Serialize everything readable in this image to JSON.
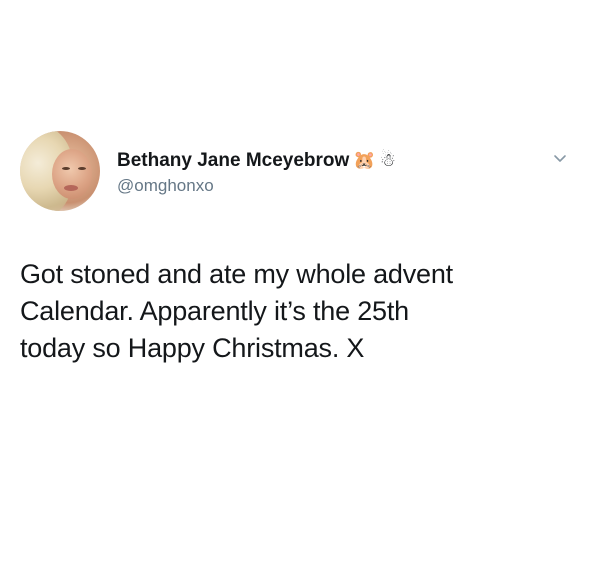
{
  "tweet": {
    "author_name": "Bethany Jane Mceyebrow",
    "author_emojis": [
      "🐹",
      "☃"
    ],
    "handle": "@omghonxo",
    "text_lines": [
      "Got stoned and ate my whole advent",
      "Calendar. Apparently it’s the 25th",
      "today so Happy Christmas. X"
    ],
    "avatar_icon": "profile-photo",
    "menu_icon": "chevron-down-icon"
  }
}
